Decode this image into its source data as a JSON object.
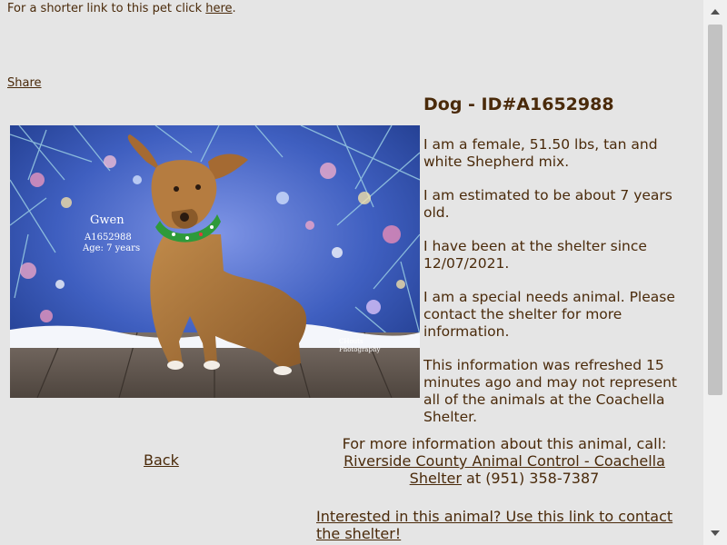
{
  "header": {
    "short_link_text": "For a shorter link to this pet click ",
    "short_link_label": "here",
    "short_link_suffix": "."
  },
  "share_label": "Share",
  "pet": {
    "title": "Dog - ID#A1652988",
    "photo_caption_name": "Gwen",
    "photo_caption_id": "A1652988",
    "photo_caption_age": "Age: 7 years",
    "photo_watermark_line1": "CHouts",
    "photo_watermark_line2": "Photography"
  },
  "info": {
    "description": "I am a female, 51.50 lbs, tan and white Shepherd mix.",
    "age": "I am estimated to be about 7 years old.",
    "since": "I have been at the shelter since 12/07/2021.",
    "special_needs": "I am a special needs animal. Please contact the shelter for more information.",
    "refreshed": "This information was refreshed 15 minutes ago and may not represent all of the animals at the Coachella Shelter."
  },
  "nav": {
    "back_label": "Back"
  },
  "contact": {
    "intro": "For more information about this animal, call:",
    "shelter_link": "Riverside County Animal Control - Coachella Shelter",
    "phone_text": " at (951) 358-7387"
  },
  "interest_link": "Interested in this animal? Use this link to contact the shelter!",
  "colors": {
    "background": "#e5e5e5",
    "text": "#4a2a0a"
  }
}
